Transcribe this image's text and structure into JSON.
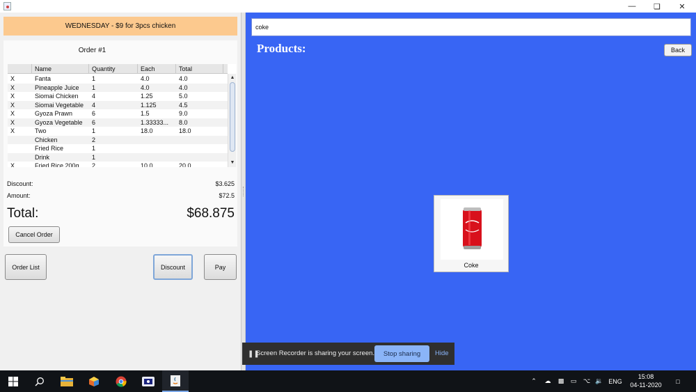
{
  "window": {
    "minimize_icon": "minimize-icon",
    "restore_icon": "restore-icon",
    "close_icon": "close-icon"
  },
  "promo": {
    "text": "WEDNESDAY - $9 for 3pcs chicken",
    "color": "#fcc98e"
  },
  "order": {
    "title": "Order #1",
    "columns": [
      "",
      "Name",
      "Quantity",
      "Each",
      "Total"
    ],
    "rows": [
      {
        "x": "X",
        "name": "Fanta",
        "qty": "1",
        "each": "4.0",
        "total": "4.0"
      },
      {
        "x": "X",
        "name": "Pineapple Juice",
        "qty": "1",
        "each": "4.0",
        "total": "4.0"
      },
      {
        "x": "X",
        "name": "Siomai Chicken",
        "qty": "4",
        "each": "1.25",
        "total": "5.0"
      },
      {
        "x": "X",
        "name": "Siomai Vegetable",
        "qty": "4",
        "each": "1.125",
        "total": "4.5"
      },
      {
        "x": "X",
        "name": "Gyoza Prawn",
        "qty": "6",
        "each": "1.5",
        "total": "9.0"
      },
      {
        "x": "X",
        "name": "Gyoza Vegetable",
        "qty": "6",
        "each": "1.33333...",
        "total": "8.0"
      },
      {
        "x": "X",
        "name": "Two",
        "qty": "1",
        "each": "18.0",
        "total": "18.0"
      },
      {
        "x": "",
        "name": "Chicken",
        "qty": "2",
        "each": "",
        "total": ""
      },
      {
        "x": "",
        "name": "Fried Rice",
        "qty": "1",
        "each": "",
        "total": ""
      },
      {
        "x": "",
        "name": "Drink",
        "qty": "1",
        "each": "",
        "total": ""
      },
      {
        "x": "X",
        "name": "Fried Rice 200g",
        "qty": "2",
        "each": "10.0",
        "total": "20.0"
      }
    ],
    "discount_label": "Discount:",
    "discount_value": "$3.625",
    "amount_label": "Amount:",
    "amount_value": "$72.5",
    "total_label": "Total:",
    "total_value": "$68.875",
    "cancel_label": "Cancel Order"
  },
  "actions": {
    "order_list": "Order List",
    "discount": "Discount",
    "pay": "Pay"
  },
  "products": {
    "search_value": "coke",
    "title": "Products:",
    "back_label": "Back",
    "panel_color": "#3865f4",
    "items": [
      {
        "label": "Coke",
        "icon": "coke-can-icon"
      }
    ]
  },
  "share_bar": {
    "message": "Screen Recorder is sharing your screen.",
    "stop_label": "Stop sharing",
    "hide_label": "Hide"
  },
  "taskbar": {
    "language": "ENG",
    "time": "15:08",
    "date": "04-11-2020"
  }
}
